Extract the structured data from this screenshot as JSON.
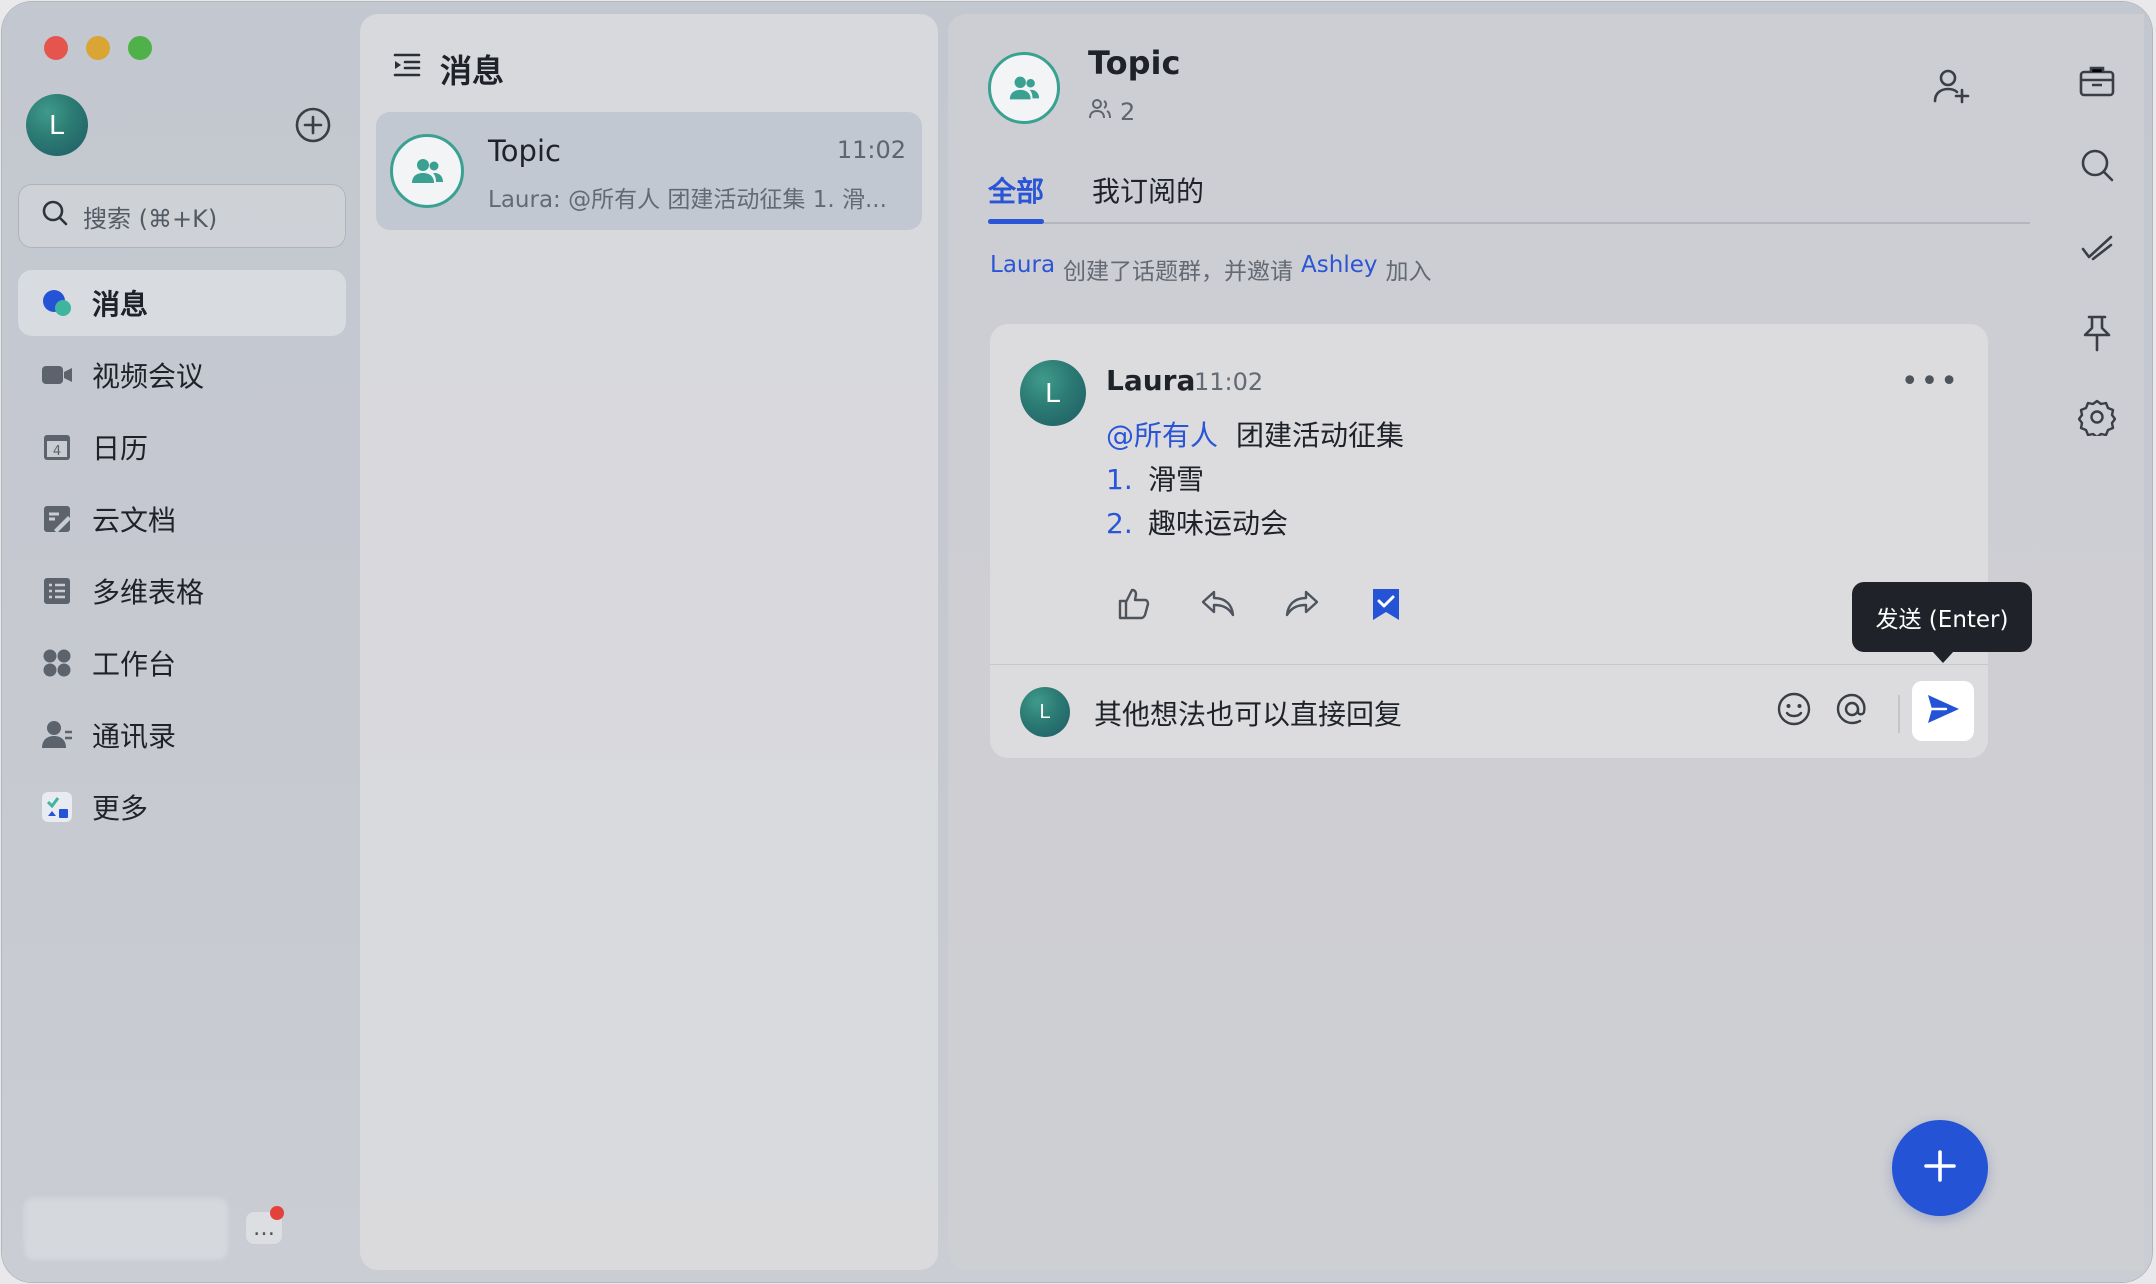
{
  "sidebar": {
    "avatar_letter": "L",
    "search_placeholder": "搜索 (⌘+K)",
    "items": [
      {
        "label": "消息",
        "icon": "message-icon",
        "active": true
      },
      {
        "label": "视频会议",
        "icon": "video-icon"
      },
      {
        "label": "日历",
        "icon": "calendar-icon",
        "badge": "4"
      },
      {
        "label": "云文档",
        "icon": "docs-icon"
      },
      {
        "label": "多维表格",
        "icon": "base-icon"
      },
      {
        "label": "工作台",
        "icon": "workplace-icon"
      },
      {
        "label": "通讯录",
        "icon": "contacts-icon"
      },
      {
        "label": "更多",
        "icon": "more-apps-icon"
      }
    ],
    "bottom_more": "…"
  },
  "list": {
    "header": "消息",
    "conversations": [
      {
        "title": "Topic",
        "time": "11:02",
        "preview": "Laura: @所有人 团建活动征集 1. 滑..."
      }
    ]
  },
  "chat": {
    "title": "Topic",
    "member_count": "2",
    "tabs": [
      "全部",
      "我订阅的"
    ],
    "system": {
      "actor": "Laura",
      "text1": "创建了话题群，并邀请",
      "target": "Ashley",
      "text2": "加入"
    },
    "message": {
      "avatar_letter": "L",
      "sender": "Laura",
      "time": "11:02",
      "mention": "@所有人",
      "title": "团建活动征集",
      "list": [
        {
          "num": "1.",
          "text": "滑雪"
        },
        {
          "num": "2.",
          "text": "趣味运动会"
        }
      ],
      "more": "•••"
    },
    "reply": {
      "avatar_letter": "L",
      "text": "其他想法也可以直接回复"
    },
    "tooltip": "发送 (Enter)"
  },
  "colors": {
    "accent": "#2a55d6",
    "group_ring": "#3aa192",
    "fab": "#2553d6"
  }
}
